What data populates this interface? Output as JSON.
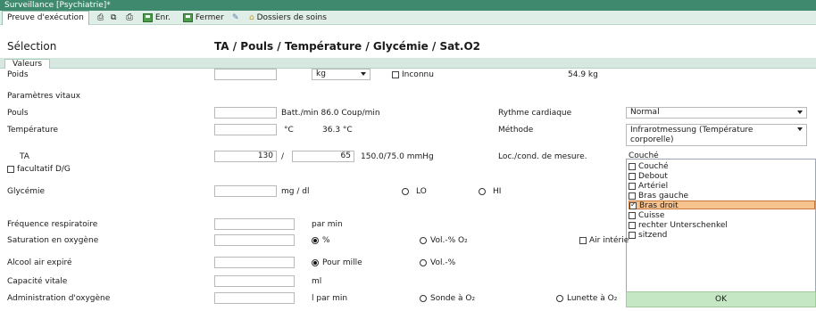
{
  "window": {
    "title": "Surveillance [Psychiatrie]*"
  },
  "toolbar": {
    "tab_label": "Preuve d'exécution",
    "save_label": "Enr.",
    "close_label": "Fermer",
    "dossiers_label": "Dossiers de soins"
  },
  "selection": {
    "label": "Sélection",
    "title": "TA / Pouls / Température / Glycémie / Sat.O2"
  },
  "values_tab": "Valeurs",
  "poids": {
    "label": "Poids",
    "unit": "kg",
    "unknown_label": "Inconnu",
    "last_value": "54.9 kg"
  },
  "vitals_heading": "Paramètres vitaux",
  "pouls": {
    "label": "Pouls",
    "unit_last": "Batt./min 86.0 Coup/min"
  },
  "rythme": {
    "label": "Rythme cardiaque",
    "value": "Normal"
  },
  "temperature": {
    "label": "Température",
    "unit": "°C",
    "last": "36.3 °C"
  },
  "methode": {
    "label": "Méthode",
    "value": "Infrarotmessung (Température corporelle)"
  },
  "ta": {
    "label": "TA",
    "systolic": "130",
    "separator": "/",
    "diastolic": "65",
    "last": "150.0/75.0 mmHg",
    "optional_label": "facultatif D/G"
  },
  "loc": {
    "label": "Loc./cond. de mesure.",
    "value": "Couché",
    "options": [
      {
        "label": "Couché",
        "checked": false
      },
      {
        "label": "Debout",
        "checked": false
      },
      {
        "label": "Artériel",
        "checked": false
      },
      {
        "label": "Bras gauche",
        "checked": false
      },
      {
        "label": "Bras droit",
        "checked": true
      },
      {
        "label": "Cuisse",
        "checked": false
      },
      {
        "label": "rechter Unterschenkel",
        "checked": false
      },
      {
        "label": "sitzend",
        "checked": false
      }
    ]
  },
  "glycemie": {
    "label": "Glycémie",
    "unit": "mg / dl",
    "lo": "LO",
    "hi": "HI"
  },
  "frequence": {
    "label": "Fréquence respiratoire",
    "unit": "par min"
  },
  "saturation": {
    "label": "Saturation en oxygène",
    "pct": "%",
    "vol": "Vol.-% O₂",
    "air": "Air intérie"
  },
  "alcool": {
    "label": "Alcool air expiré",
    "permille": "Pour mille",
    "vol": "Vol.-%"
  },
  "capacite": {
    "label": "Capacité vitale",
    "unit": "ml"
  },
  "admin_o2": {
    "label": "Administration d'oxygène",
    "unit": "l par min",
    "sonde": "Sonde à O₂",
    "lunette": "Lunette à O₂"
  },
  "ok_label": "OK"
}
